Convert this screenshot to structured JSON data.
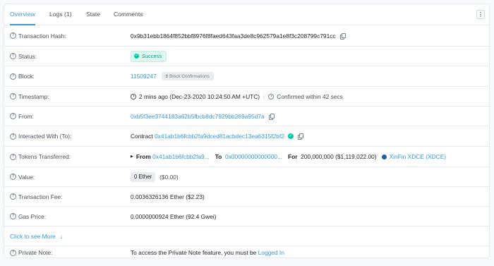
{
  "tabs": [
    {
      "label": "Overview"
    },
    {
      "label": "Logs (1)"
    },
    {
      "label": "State"
    },
    {
      "label": "Comments"
    }
  ],
  "more_button_icon": "vertical-ellipsis-icon",
  "rows": {
    "tx_hash": {
      "label": "Transaction Hash:",
      "value": "0x9b31ebb1864f852bbf8976f8faed643faa3de8c962579a1e8f3c208799c791cc"
    },
    "status": {
      "label": "Status:",
      "value": "Success"
    },
    "block": {
      "label": "Block:",
      "value": "11509247",
      "confirmations": "8 Block Confirmations"
    },
    "timestamp": {
      "label": "Timestamp:",
      "value": "2 mins ago (Dec-23-2020 10:24:50 AM +UTC)",
      "confirmed": "Confirmed within 42 secs"
    },
    "from": {
      "label": "From:",
      "value": "0xb5f3ee3744183a62b5fbcb8dc7929bb269a95d7a"
    },
    "interacted": {
      "label": "Interacted With (To):",
      "prefix": "Contract",
      "value": "0x41ab1b6fcbb2fa9dced81acbdec13ea6315f2bf2"
    },
    "tokens": {
      "label": "Tokens Transferred:",
      "from_label": "From",
      "from_value": "0x41ab1b6fcbb2fa9...",
      "to_label": "To",
      "to_value": "0x00000000000000...",
      "for_label": "For",
      "amount": "200,000,000",
      "usd": "($1,119,022.00)",
      "token_name": "XinFin XDCE (XDCE)"
    },
    "value": {
      "label": "Value:",
      "ether": "0 Ether",
      "usd": "($0.00)"
    },
    "fee": {
      "label": "Transaction Fee:",
      "value": "0.0036326136 Ether ($2.23)"
    },
    "gas": {
      "label": "Gas Price:",
      "value": "0.0000000924 Ether (92.4 Gwei)"
    },
    "see_more": {
      "label": "Click to see More"
    },
    "note": {
      "label": "Private Note:",
      "text": "To access the Private Note feature, you must be",
      "link": "Logged In"
    }
  },
  "colors": {
    "accent": "#3498db",
    "success": "#00c9a7",
    "border": "#e7eaf3"
  }
}
